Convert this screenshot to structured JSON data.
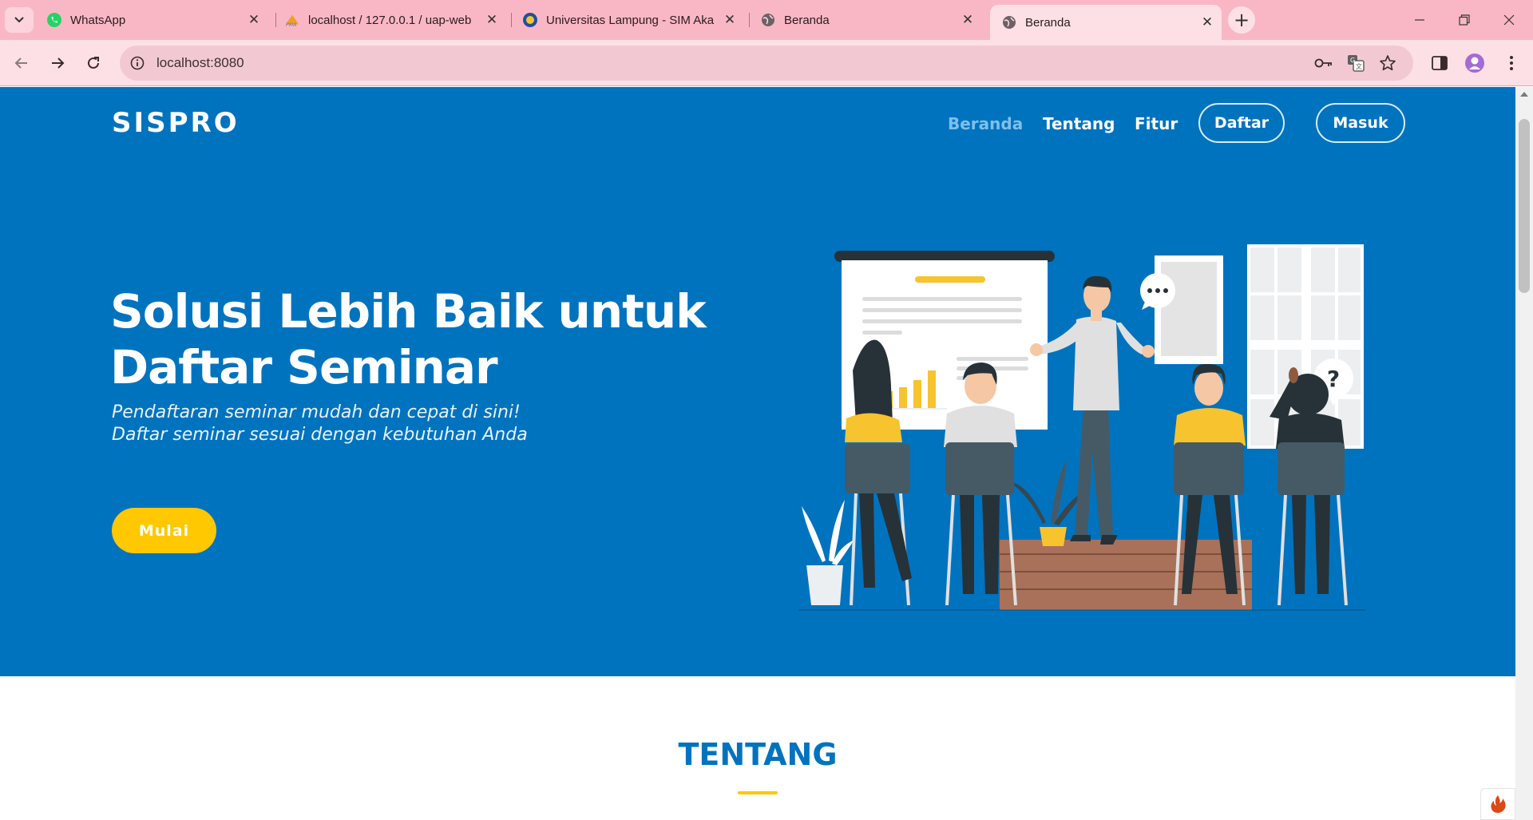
{
  "browser": {
    "tabs": [
      {
        "title": "WhatsApp",
        "icon": "whatsapp-icon"
      },
      {
        "title": "localhost / 127.0.0.1 / uap-web",
        "icon": "phpmyadmin-icon"
      },
      {
        "title": "Universitas Lampung - SIM Aka",
        "icon": "unila-icon"
      },
      {
        "title": "Beranda",
        "icon": "globe-icon"
      },
      {
        "title": "Beranda",
        "icon": "globe-icon",
        "active": true
      }
    ],
    "address": "localhost:8080",
    "colors": {
      "chrome": "#f9b7c5",
      "toolbar": "#fde0e6"
    }
  },
  "site": {
    "brand": "SISPRO",
    "nav": {
      "beranda": "Beranda",
      "tentang": "Tentang",
      "fitur": "Fitur",
      "daftar": "Daftar",
      "masuk": "Masuk"
    },
    "hero": {
      "title_line1": "Solusi Lebih Baik untuk",
      "title_line2": "Daftar Seminar",
      "subtitle_line1": "Pendaftaran seminar mudah dan cepat di sini!",
      "subtitle_line2": "Daftar seminar sesuai dengan kebutuhan Anda",
      "cta": "Mulai",
      "illustration": "seminar-presentation-illustration"
    },
    "section": {
      "title": "TENTANG"
    },
    "colors": {
      "primary": "#0073bf",
      "accent": "#ffc800",
      "nav_active": "#7ec0ea"
    }
  }
}
